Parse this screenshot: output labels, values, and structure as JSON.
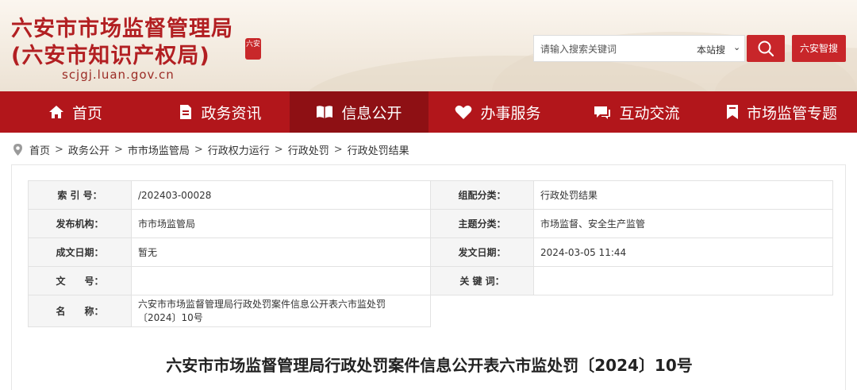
{
  "header": {
    "title_line1": "六安市市场监督管理局",
    "title_line2": "(六安市知识产权局)",
    "domain": "scjgj.luan.gov.cn",
    "seal_text": "六安"
  },
  "search": {
    "placeholder": "请输入搜索关键词",
    "scope": "本站搜",
    "smart_label": "六安智搜"
  },
  "nav": {
    "items": [
      {
        "label": "首页",
        "icon": "home-icon"
      },
      {
        "label": "政务资讯",
        "icon": "news-icon"
      },
      {
        "label": "信息公开",
        "icon": "open-book-icon",
        "active": true
      },
      {
        "label": "办事服务",
        "icon": "heart-icon"
      },
      {
        "label": "互动交流",
        "icon": "chat-icon"
      },
      {
        "label": "市场监管专题",
        "icon": "bookmark-icon"
      }
    ]
  },
  "breadcrumb": [
    "首页",
    "政务公开",
    "市市场监管局",
    "行政权力运行",
    "行政处罚",
    "行政处罚结果"
  ],
  "meta": {
    "rows": [
      {
        "l1": "索 引 号：",
        "v1": "/202403-00028",
        "l2": "组配分类：",
        "v2": "行政处罚结果"
      },
      {
        "l1": "发布机构：",
        "v1": "市市场监管局",
        "l2": "主题分类：",
        "v2": "市场监督、安全生产监管"
      },
      {
        "l1": "成文日期：",
        "v1": "暂无",
        "l2": "发文日期：",
        "v2": "2024-03-05 11:44"
      },
      {
        "l1": "文　　号：",
        "v1": "",
        "l2": "关 键 词：",
        "v2": ""
      },
      {
        "l1": "名　　称：",
        "v1": "六安市市场监督管理局行政处罚案件信息公开表六市监处罚〔2024〕10号"
      }
    ]
  },
  "document_title": "六安市市场监督管理局行政处罚案件信息公开表六市监处罚〔2024〕10号",
  "colors": {
    "brand_red": "#b2161b",
    "active_nav": "#8e1014",
    "button_red": "#c8262a"
  }
}
